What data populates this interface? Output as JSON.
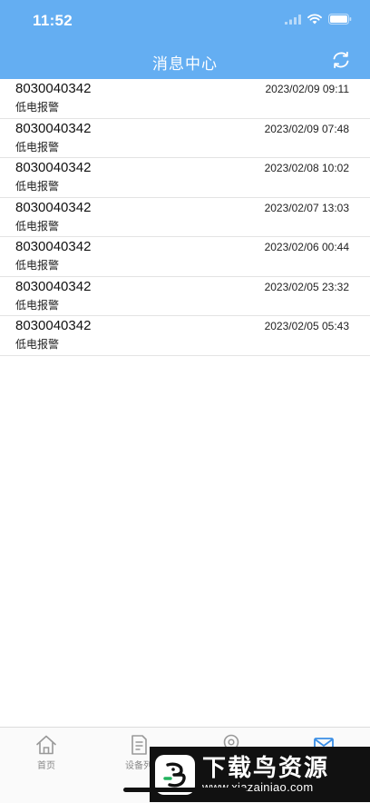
{
  "status_bar": {
    "time": "11:52"
  },
  "header": {
    "title": "消息中心"
  },
  "messages": [
    {
      "id": "8030040342",
      "type": "低电报警",
      "time": "2023/02/09 09:11"
    },
    {
      "id": "8030040342",
      "type": "低电报警",
      "time": "2023/02/09 07:48"
    },
    {
      "id": "8030040342",
      "type": "低电报警",
      "time": "2023/02/08 10:02"
    },
    {
      "id": "8030040342",
      "type": "低电报警",
      "time": "2023/02/07 13:03"
    },
    {
      "id": "8030040342",
      "type": "低电报警",
      "time": "2023/02/06 00:44"
    },
    {
      "id": "8030040342",
      "type": "低电报警",
      "time": "2023/02/05 23:32"
    },
    {
      "id": "8030040342",
      "type": "低电报警",
      "time": "2023/02/05 05:43"
    }
  ],
  "tabbar": {
    "items": [
      {
        "label": "首页",
        "icon": "home-icon"
      },
      {
        "label": "设备列",
        "icon": "device-list-icon"
      },
      {
        "label": "",
        "icon": "location-icon"
      },
      {
        "label": "",
        "icon": "mail-icon"
      }
    ],
    "active_index": 3
  },
  "watermark": {
    "name": "下载鸟资源",
    "url": "www.xiazainiao.com"
  },
  "colors": {
    "header": "#64aef2",
    "active_tab": "#3a8ee6",
    "divider": "#e3e3e3"
  }
}
